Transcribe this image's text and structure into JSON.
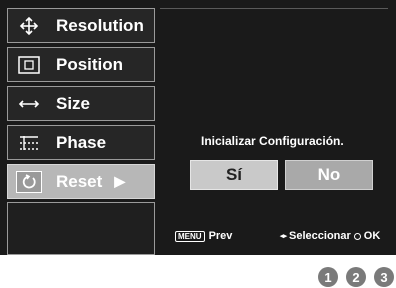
{
  "menu": {
    "items": [
      {
        "label": "Resolution",
        "icon": "move-arrows-icon"
      },
      {
        "label": "Position",
        "icon": "position-icon"
      },
      {
        "label": "Size",
        "icon": "horizontal-arrow-icon"
      },
      {
        "label": "Phase",
        "icon": "phase-grid-icon"
      },
      {
        "label": "Reset",
        "icon": "reset-icon",
        "selected": true
      }
    ]
  },
  "dialog": {
    "prompt": "Inicializar Configuración.",
    "yes_label": "Sí",
    "no_label": "No"
  },
  "footer": {
    "menu_key": "MENU",
    "prev": "Prev",
    "select": "Seleccionar",
    "ok": "OK"
  },
  "steps": [
    "1",
    "2",
    "3"
  ],
  "colors": {
    "background": "#1a1a1a",
    "selected_item": "#b7b7b7",
    "button_yes": "#c9c9c9",
    "button_no": "#a9a9a9"
  }
}
